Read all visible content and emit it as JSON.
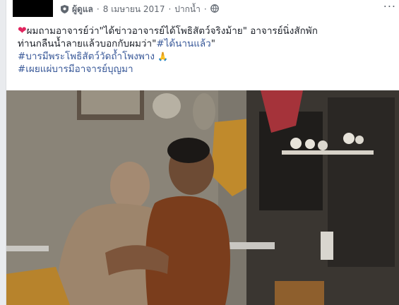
{
  "post": {
    "author_role": "ผู้ดูแล",
    "separator": "·",
    "date": "8 เมษายน 2017",
    "privacy": "ปากน้ำ",
    "more_label": "...",
    "text_line1": "ผมถามอาจารย์ว่า\"ได้ข่าวอาจารย์ได้โพธิสัตว์จริงม้าย\" อาจารย์นิ่งสักพัก",
    "text_line2_plain": "ท่านกลืนน้ำลายแล้วบอกกับผมว่า\"",
    "text_line2_tag": "#ได้นานแล้ว",
    "text_line2_end": "\"",
    "hashtag1": "#บารมีพระโพธิสัตว์วัดถ้ำโพงพาง",
    "pray_emoji": "🙏",
    "hashtag2": "#เผยแผ่บารมีอาจารย์บุญมา",
    "heart": "❤"
  },
  "colors": {
    "link": "#385898",
    "text": "#1d2129",
    "meta": "#616770",
    "heart": "#e0245e"
  },
  "icons": [
    "shield-admin-icon",
    "globe-icon",
    "heart-emoji",
    "pray-emoji"
  ]
}
